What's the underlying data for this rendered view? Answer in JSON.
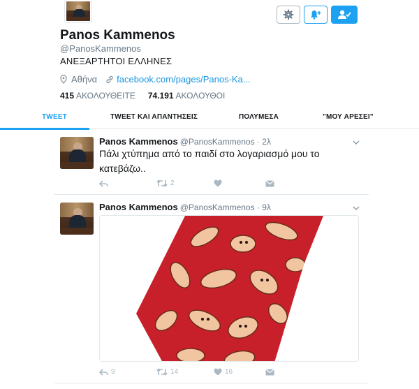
{
  "profile": {
    "name": "Panos Kammenos",
    "handle": "@PanosKammenos",
    "bio": "ΑΝΕΞΑΡΤΗΤΟΙ ΕΛΛΗΝΕΣ",
    "location": "Αθήνα",
    "link": "facebook.com/pages/Panos-Ka...",
    "following_count": "415",
    "following_label": "ΑΚΟΛΟΥΘΕΙΤΕ",
    "followers_count": "74.191",
    "followers_label": "ΑΚΟΛΟΥΘΟΙ"
  },
  "header_buttons": {
    "settings_icon": "gear-icon",
    "notify_icon": "bell-plus-icon",
    "following_icon": "user-check-icon"
  },
  "tabs": [
    {
      "label": "TWEET",
      "active": true
    },
    {
      "label": "TWEET ΚΑΙ ΑΠΑΝΤΗΣΕΙΣ",
      "active": false
    },
    {
      "label": "ΠΟΛΥΜΕΣΑ",
      "active": false
    },
    {
      "label": "\"ΜΟΥ ΑΡΕΣΕΙ\"",
      "active": false
    }
  ],
  "tweets": [
    {
      "name": "Panos Kammenos",
      "handle": "@PanosKammenos · 2λ",
      "text": "Πάλι χτύπημα από το παιδί στο λογαριασμό μου το κατεβάζω..",
      "replies": "",
      "retweets": "2",
      "likes": ""
    },
    {
      "name": "Panos Kammenos",
      "handle": "@PanosKammenos · 9λ",
      "text": "",
      "replies": "9",
      "retweets": "14",
      "likes": "16"
    }
  ],
  "colors": {
    "accent": "#1da1f2",
    "text": "#14171a",
    "muted": "#657786",
    "tie_red": "#c8202a"
  }
}
